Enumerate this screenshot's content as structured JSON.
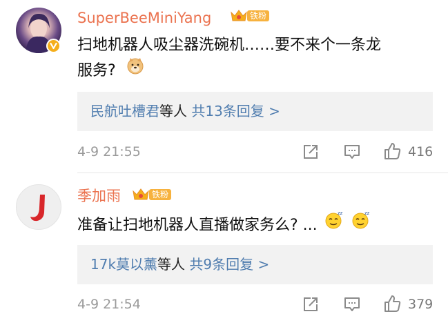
{
  "comments": [
    {
      "username": "SuperBeeMiniYang",
      "badge": "铁粉",
      "text_line1": "扫地机器人吸尘器洗碗机……要不来个一条龙",
      "text_line2": "服务?",
      "emoji_icons": [
        "doge-emoji-icon"
      ],
      "replies": {
        "names": "民航吐槽君",
        "middle": "等人",
        "count": "共13条回复 >"
      },
      "time": "4-9 21:55",
      "likes": "416"
    },
    {
      "username": "季加雨",
      "badge": "铁粉",
      "text": "准备让扫地机器人直播做家务么? ...",
      "emoji_icons": [
        "sleepy-emoji-icon",
        "sleepy-emoji-icon"
      ],
      "replies": {
        "names": "17k莫以薰",
        "middle": "等人",
        "count": "共9条回复 >"
      },
      "time": "4-9 21:54",
      "likes": "379"
    }
  ],
  "colors": {
    "username": "#eb7350",
    "reply_link": "#507daf",
    "badge": "#f7b23e",
    "verified": "#f5ae1b",
    "reply_bg": "#f2f2f2",
    "meta": "#9a9a9a"
  },
  "icons": {
    "share": "share-icon",
    "comment": "comment-icon",
    "like": "thumbs-up-icon",
    "crown": "crown-icon",
    "verified": "verified-icon"
  }
}
